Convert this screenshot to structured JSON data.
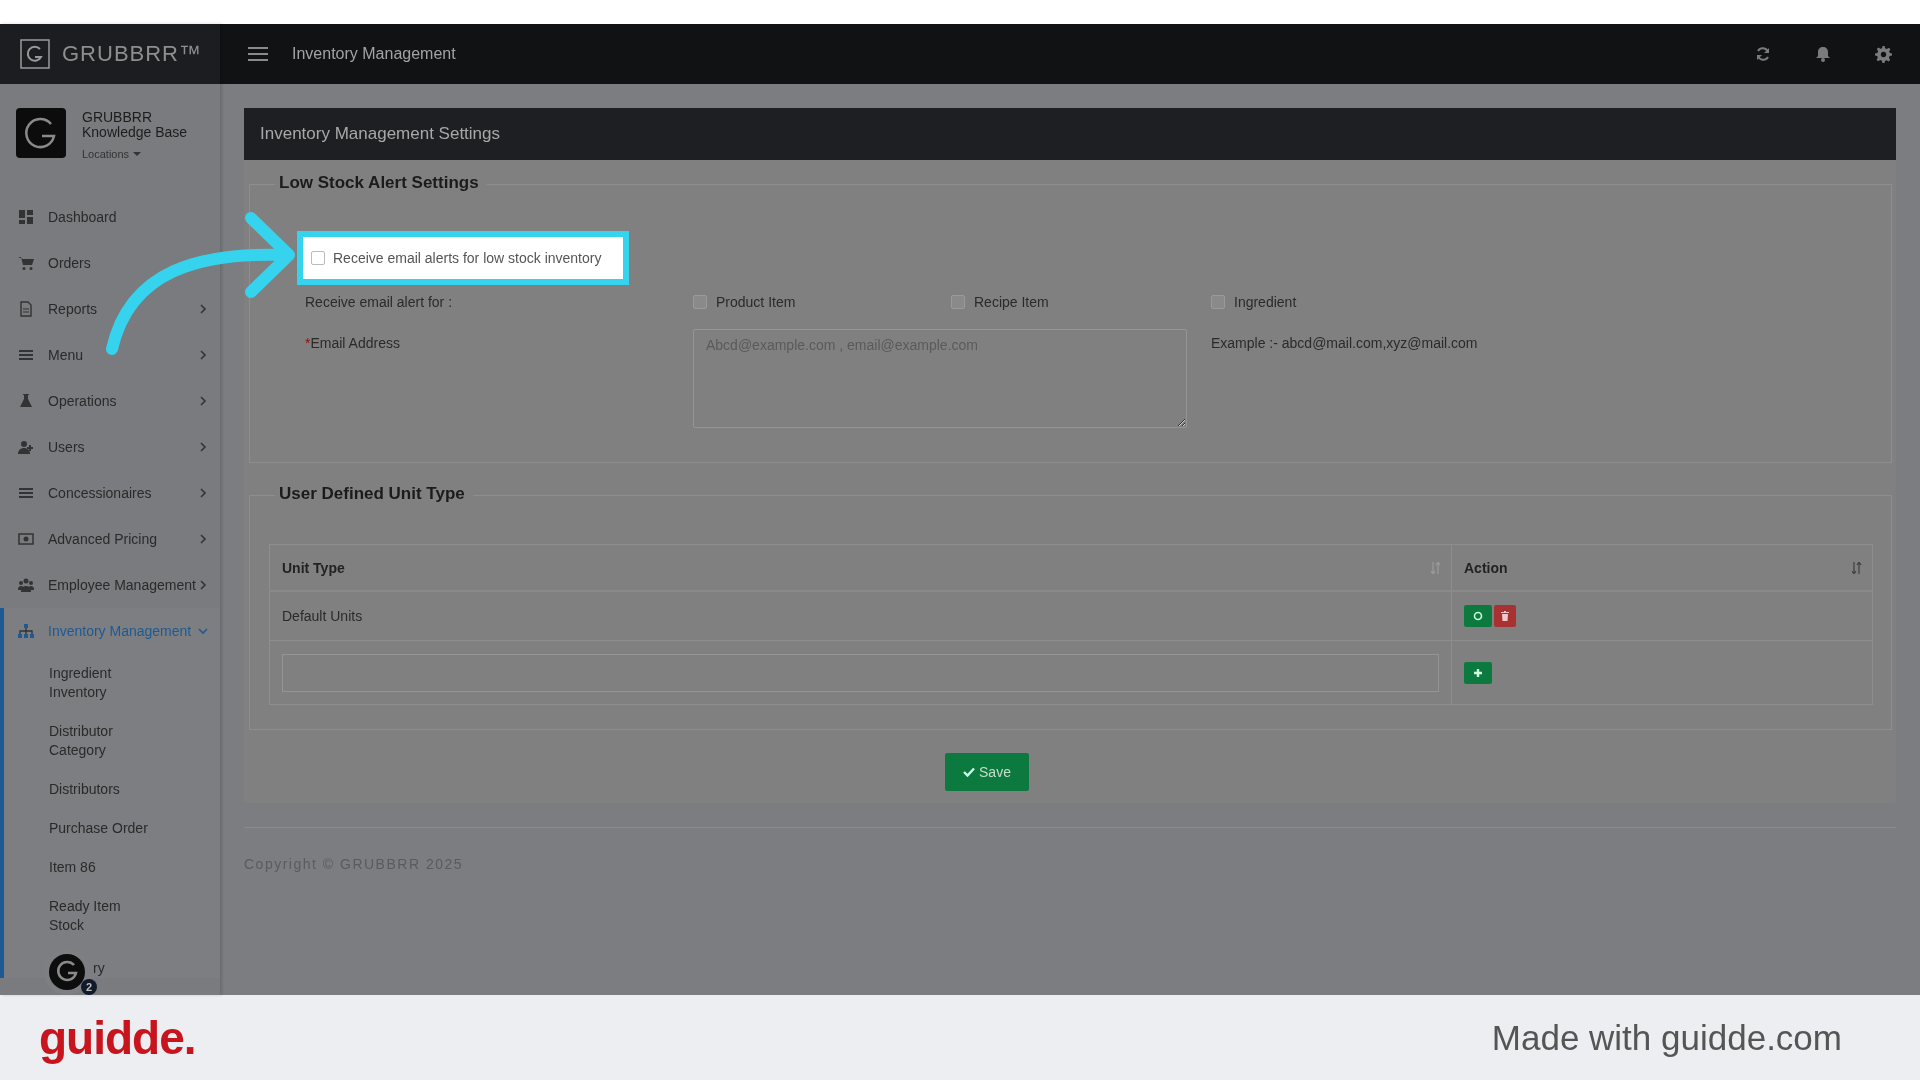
{
  "brand": {
    "logo_text": "GRUBBRR™"
  },
  "top_bar": {
    "title": "Inventory Management"
  },
  "profile": {
    "name": "GRUBBRR Knowledge Base",
    "locations": "Locations"
  },
  "sidebar": {
    "items": [
      {
        "label": "Dashboard",
        "has_children": false,
        "selected": false
      },
      {
        "label": "Orders",
        "has_children": false,
        "selected": false
      },
      {
        "label": "Reports",
        "has_children": true,
        "expanded": false,
        "selected": false
      },
      {
        "label": "Menu",
        "has_children": true,
        "expanded": false,
        "selected": false
      },
      {
        "label": "Operations",
        "has_children": true,
        "expanded": false,
        "selected": false
      },
      {
        "label": "Users",
        "has_children": true,
        "expanded": false,
        "selected": false
      },
      {
        "label": "Concessionaires",
        "has_children": true,
        "expanded": false,
        "selected": false
      },
      {
        "label": "Advanced Pricing",
        "has_children": true,
        "expanded": false,
        "selected": false
      },
      {
        "label": "Employee Management",
        "has_children": true,
        "expanded": false,
        "selected": false
      },
      {
        "label": "Inventory Management",
        "has_children": true,
        "expanded": true,
        "selected": true,
        "children": [
          {
            "label": "Ingredient Inventory"
          },
          {
            "label": "Distributor Category"
          },
          {
            "label": "Distributors"
          },
          {
            "label": "Purchase Order"
          },
          {
            "label": "Item 86"
          },
          {
            "label": "Ready Item Stock"
          },
          {
            "label": "ry"
          }
        ]
      }
    ]
  },
  "help_avatar": {
    "badge": "2"
  },
  "panel": {
    "title": "Inventory Management Settings",
    "low_stock": {
      "legend": "Low Stock Alert Settings",
      "enable": {
        "label": "Receive email alerts for low stock inventory",
        "checked": false,
        "highlighted": true
      },
      "alert_for_label": "Receive email alert for :",
      "alert_for": [
        {
          "label": "Product Item",
          "checked": false
        },
        {
          "label": "Recipe Item",
          "checked": false
        },
        {
          "label": "Ingredient",
          "checked": false
        }
      ],
      "email": {
        "label": "Email Address",
        "required_mark": "*",
        "placeholder": "Abcd@example.com , email@example.com"
      },
      "example": "Example :- abcd@mail.com,xyz@mail.com"
    },
    "unit_types": {
      "legend": "User Defined Unit Type",
      "columns": [
        "Unit Type",
        "Action"
      ],
      "rows": [
        {
          "unit_type": "Default Units"
        }
      ]
    },
    "save": "Save"
  },
  "footer": {
    "copyright": "Copyright © GRUBBRR 2025"
  },
  "callout": {
    "kind": "arrow"
  },
  "guidde_bar": {
    "logo": "guidde.",
    "tagline": "Made with guidde.com"
  }
}
